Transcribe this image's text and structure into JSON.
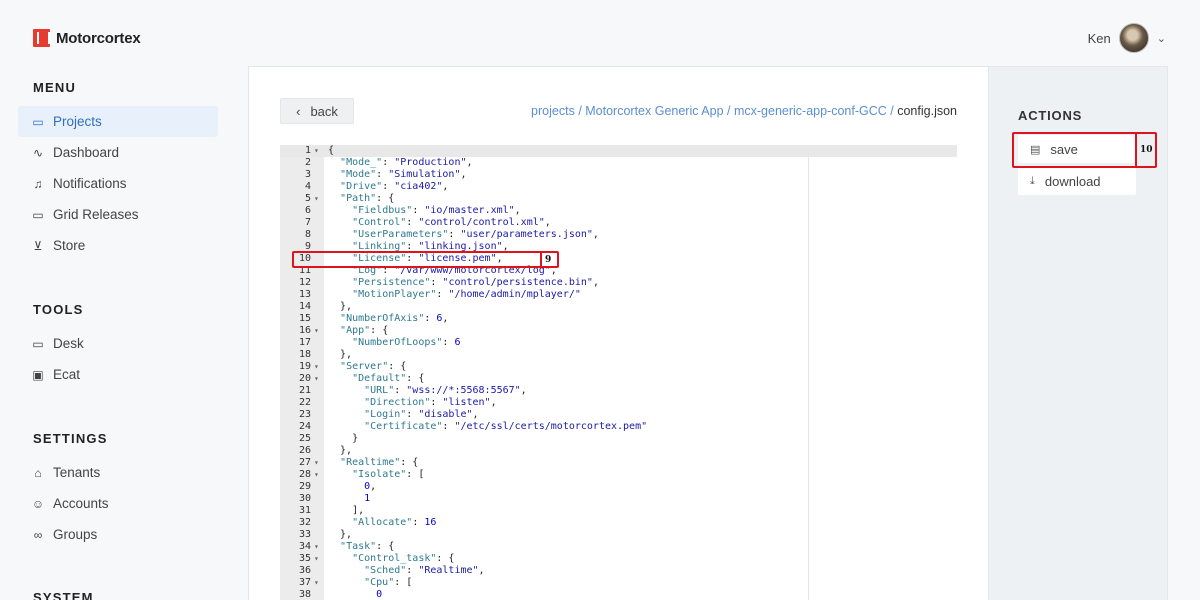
{
  "app": {
    "logo_text": "Motorcortex",
    "user_name": "Ken"
  },
  "sidebar": {
    "sections": [
      {
        "title": "MENU",
        "items": [
          {
            "label": "Projects",
            "icon": "folder-icon",
            "active": true
          },
          {
            "label": "Dashboard",
            "icon": "pulse-icon"
          },
          {
            "label": "Notifications",
            "icon": "bell-icon"
          },
          {
            "label": "Grid Releases",
            "icon": "monitor-icon"
          },
          {
            "label": "Store",
            "icon": "cart-icon"
          }
        ]
      },
      {
        "title": "TOOLS",
        "items": [
          {
            "label": "Desk",
            "icon": "monitor-icon"
          },
          {
            "label": "Ecat",
            "icon": "chip-icon"
          }
        ]
      },
      {
        "title": "SETTINGS",
        "items": [
          {
            "label": "Tenants",
            "icon": "house-icon"
          },
          {
            "label": "Accounts",
            "icon": "users-icon"
          },
          {
            "label": "Groups",
            "icon": "link-icon"
          }
        ]
      },
      {
        "title": "SYSTEM",
        "items": []
      }
    ]
  },
  "main": {
    "back_label": "back",
    "breadcrumb": [
      "projects",
      "Motorcortex Generic App",
      "mcx-generic-app-conf-GCC",
      "config.json"
    ]
  },
  "editor": {
    "lines": [
      "{",
      "  \"Mode_\": \"Production\",",
      "  \"Mode\": \"Simulation\",",
      "  \"Drive\": \"cia402\",",
      "  \"Path\": {",
      "    \"Fieldbus\": \"io/master.xml\",",
      "    \"Control\": \"control/control.xml\",",
      "    \"UserParameters\": \"user/parameters.json\",",
      "    \"Linking\": \"linking.json\",",
      "    \"License\": \"license.pem\",",
      "    \"Log\": \"/var/www/motorcortex/log\",",
      "    \"Persistence\": \"control/persistence.bin\",",
      "    \"MotionPlayer\": \"/home/admin/mplayer/\"",
      "  },",
      "  \"NumberOfAxis\": 6,",
      "  \"App\": {",
      "    \"NumberOfLoops\": 6",
      "  },",
      "  \"Server\": {",
      "    \"Default\": {",
      "      \"URL\": \"wss://*:5568:5567\",",
      "      \"Direction\": \"listen\",",
      "      \"Login\": \"disable\",",
      "      \"Certificate\": \"/etc/ssl/certs/motorcortex.pem\"",
      "    }",
      "  },",
      "  \"Realtime\": {",
      "    \"Isolate\": [",
      "      0,",
      "      1",
      "    ],",
      "    \"Allocate\": 16",
      "  },",
      "  \"Task\": {",
      "    \"Control_task\": {",
      "      \"Sched\": \"Realtime\",",
      "      \"Cpu\": [",
      "        0"
    ],
    "fold_lines": [
      1,
      5,
      16,
      19,
      20,
      27,
      28,
      34,
      35,
      37
    ]
  },
  "actions": {
    "title": "ACTIONS",
    "save_label": "save",
    "download_label": "download"
  },
  "annotations": {
    "license_marker": "9",
    "save_marker": "10"
  },
  "colors": {
    "accent": "#2f6fc0",
    "brand": "#e63b2e",
    "annotation": "#e0121b"
  }
}
